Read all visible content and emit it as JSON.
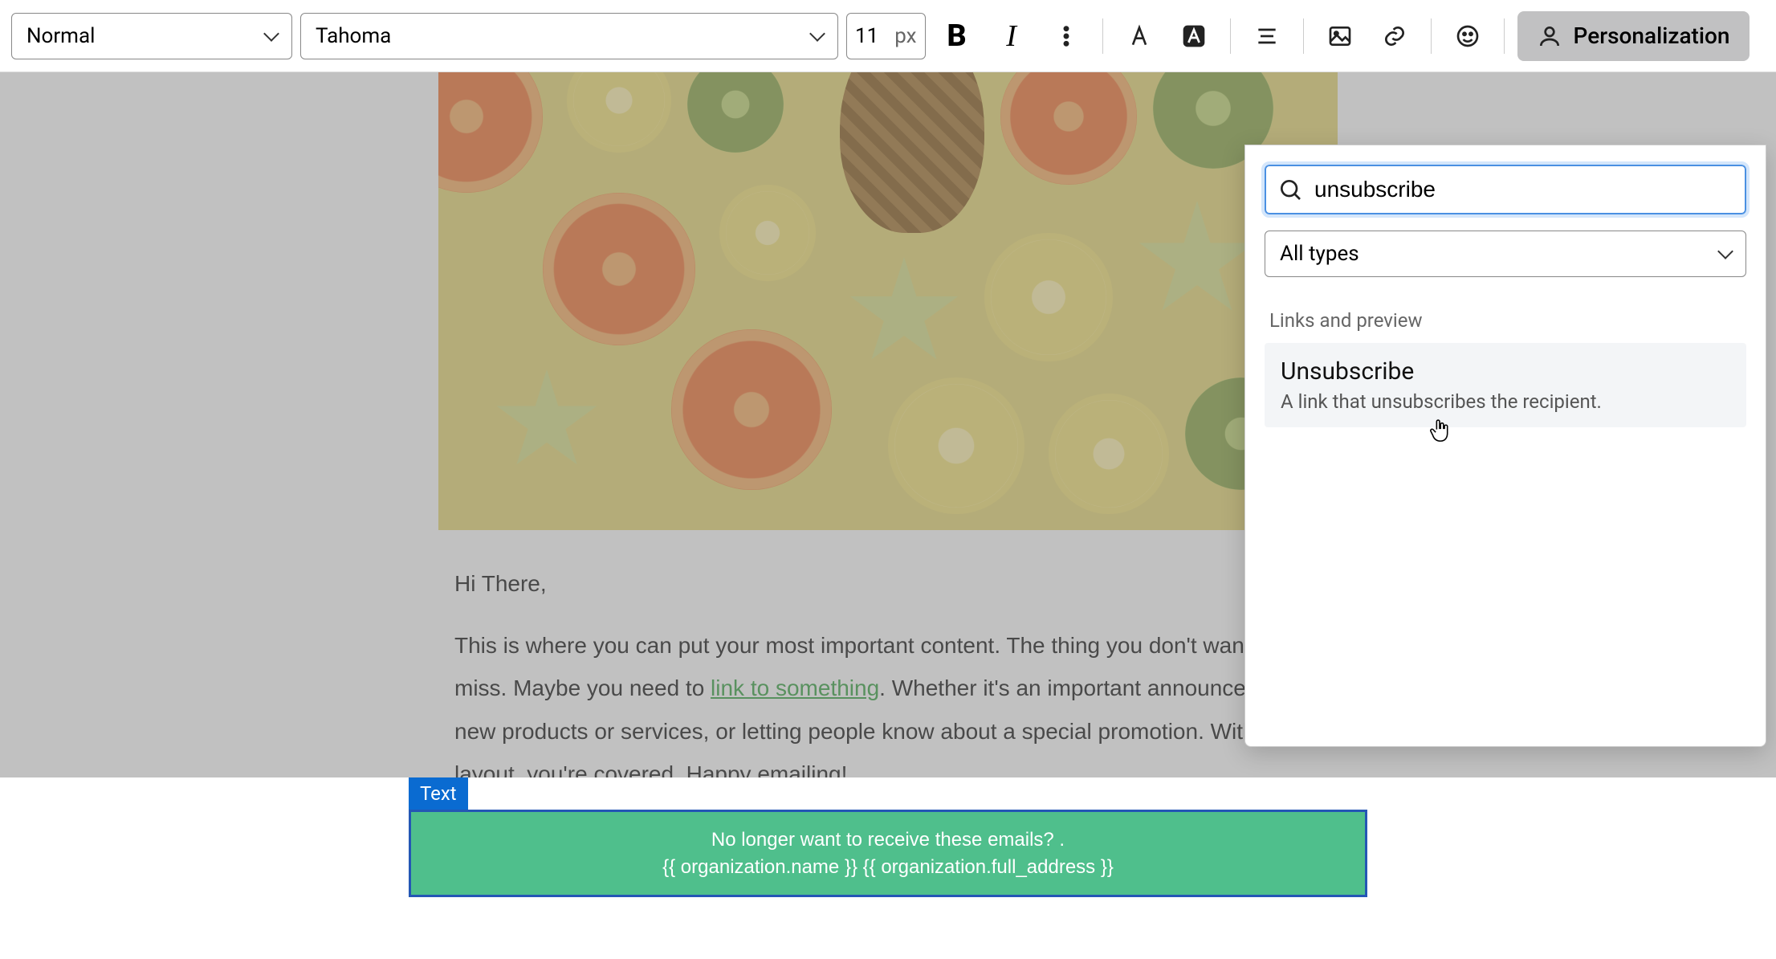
{
  "toolbar": {
    "style_select": "Normal",
    "font_select": "Tahoma",
    "font_size": "11",
    "font_size_unit": "px",
    "personalization_label": "Personalization"
  },
  "dropdown": {
    "search_value": "unsubscribe",
    "filter_label": "All types",
    "section_heading": "Links and preview",
    "result": {
      "title": "Unsubscribe",
      "desc": "A link that unsubscribes the recipient."
    }
  },
  "email": {
    "greeting": "Hi There,",
    "body_before_link": "This is where you can put your most important content. The thing you don't want to miss. Maybe you need to ",
    "link_text": "link to something",
    "body_after_link": ". Whether it's an important announcement, new products or services, or letting people know about a special promotion. With this layout, you're covered. Happy emailing!",
    "block_tag": "Text",
    "footer_line1": "No longer want to receive these emails? .",
    "footer_line2": "{{ organization.name }} {{ organization.full_address }}"
  }
}
